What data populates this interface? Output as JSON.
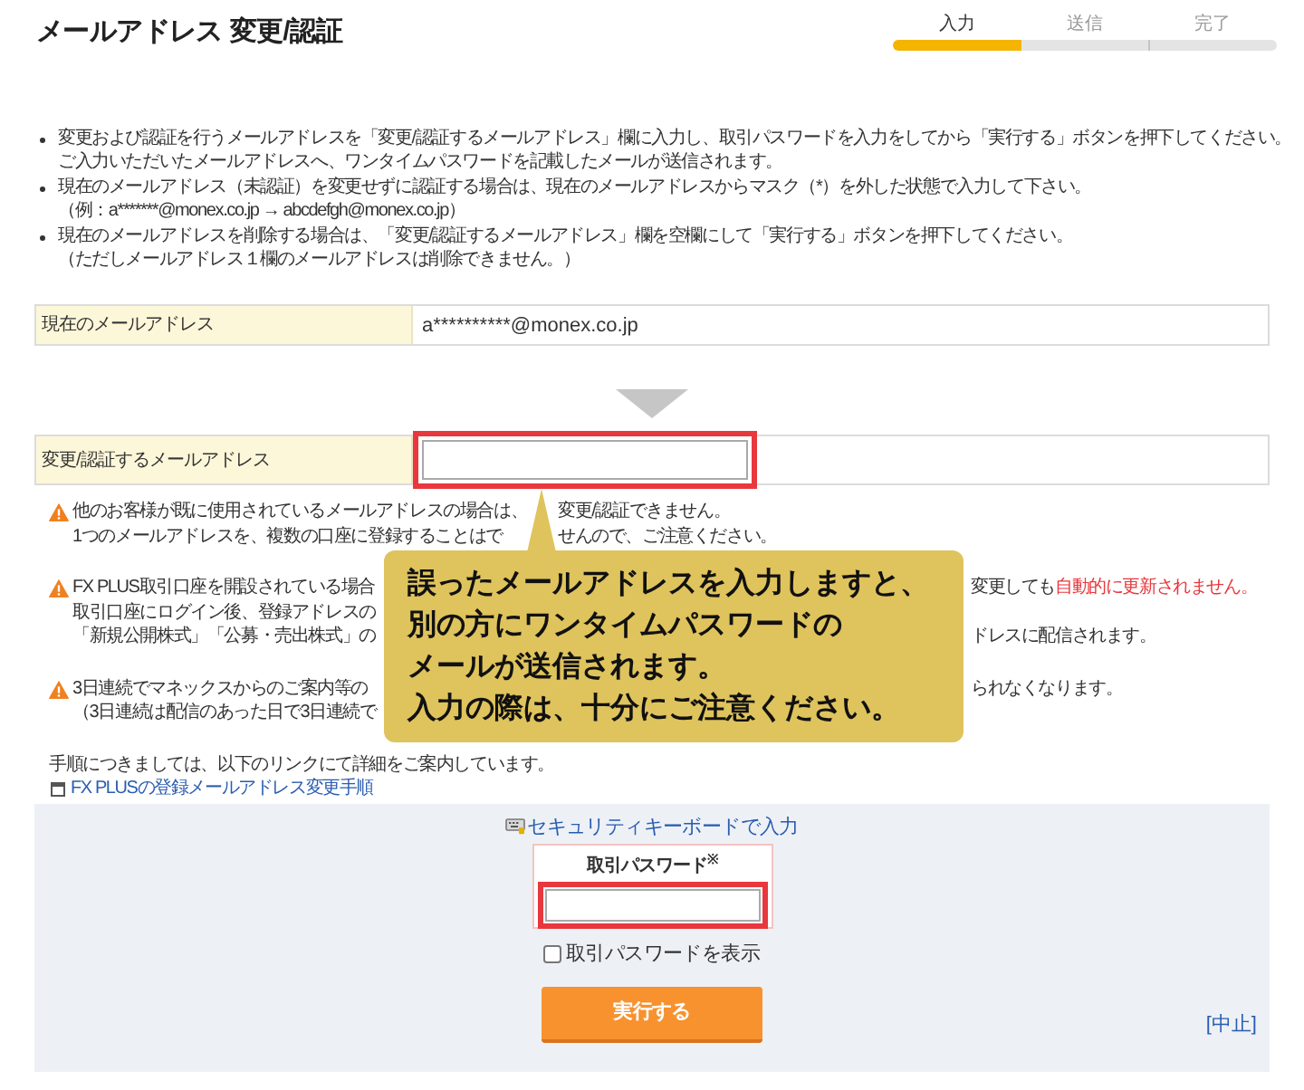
{
  "title": "メールアドレス 変更/認証",
  "steps": [
    {
      "label": "入力",
      "selected": true
    },
    {
      "label": "送信",
      "selected": false
    },
    {
      "label": "完了",
      "selected": false
    }
  ],
  "instructions": [
    {
      "lines": [
        "変更および認証を行うメールアドレスを「変更/認証するメールアドレス」欄に入力し、取引パスワードを入力をしてから「実行する」ボタンを押下してください。",
        "ご入力いただいたメールアドレスへ、ワンタイムパスワードを記載したメールが送信されます。"
      ]
    },
    {
      "lines": [
        "現在のメールアドレス（未認証）を変更せずに認証する場合は、現在のメールアドレスからマスク（*）を外した状態で入力して下さい。",
        "（例：a*******@monex.co.jp → abcdefgh@monex.co.jp）"
      ]
    },
    {
      "lines": [
        "現在のメールアドレスを削除する場合は、「変更/認証するメールアドレス」欄を空欄にして「実行する」ボタンを押下してください。",
        "（ただしメールアドレス１欄のメールアドレスは削除できません。）"
      ]
    }
  ],
  "current_email": {
    "label": "現在のメールアドレス",
    "value": "a**********@monex.co.jp"
  },
  "new_email": {
    "label": "変更/認証するメールアドレス",
    "highlighted": true
  },
  "warnings": [
    {
      "lines": [
        {
          "kind": "beside_tail",
          "left": "他のお客様が既に使用されているメールアドレスの場合は、",
          "right": [
            {
              "text": "変更/認証できません。",
              "alert": false
            }
          ]
        },
        {
          "kind": "beside_tail",
          "left": "1つのメールアドレスを、複数の口座に登録することはで",
          "right": [
            {
              "text": "せんので、ご注意ください。",
              "alert": false
            }
          ]
        }
      ]
    },
    {
      "lines": [
        {
          "kind": "beside_callout",
          "left": "FX PLUS取引口座を開設されている場合",
          "right": [
            {
              "text": "変更しても",
              "alert": false
            },
            {
              "text": "自動的に更新されません。",
              "alert": true
            }
          ]
        },
        {
          "kind": "beside_callout",
          "left": "取引口座にログイン後、登録アドレスの"
        },
        {
          "kind": "beside_callout",
          "left": "「新規公開株式」「公募・売出株式」の",
          "right": [
            {
              "text": "ドレスに配信されます。",
              "alert": false
            }
          ]
        }
      ]
    },
    {
      "lines": [
        {
          "kind": "beside_callout",
          "left": "3日連続でマネックスからのご案内等の",
          "right": [
            {
              "text": "られなくなります。",
              "alert": false
            }
          ]
        },
        {
          "kind": "beside_callout",
          "left": "（3日連続は配信のあった日で3日連続で"
        }
      ]
    }
  ],
  "procedure": {
    "text": "手順につきましては、以下のリンクにて詳細をご案内しています。",
    "link": "FX PLUSの登録メールアドレス変更手順"
  },
  "password_panel": {
    "keyboard_link": "セキュリティキーボードで入力",
    "label": "取引パスワード$^{※}$",
    "highlighted": true,
    "show_password": {
      "label": "取引パスワードを表示",
      "checked": false
    },
    "submit": "実行する",
    "cancel": "[中止]"
  },
  "callout": {
    "lines": [
      "誤ったメールアドレスを入力しますと、",
      "別の方にワンタイムパスワードの",
      "メールが送信されます。",
      "入力の際は、十分にご注意ください。"
    ]
  }
}
